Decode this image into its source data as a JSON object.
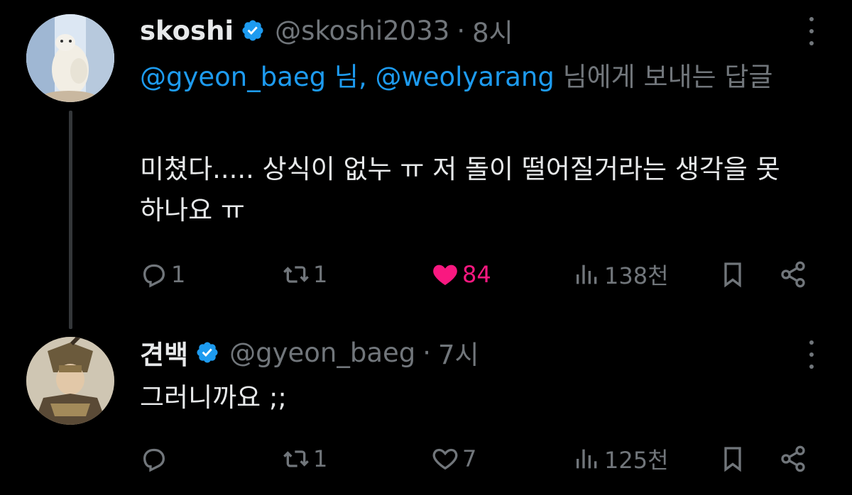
{
  "tweets": [
    {
      "name": "skoshi",
      "handle": "@skoshi2033",
      "separator": "·",
      "time": "8시",
      "reply_to": {
        "mentions": [
          "@gyeon_baeg 님,",
          "@weolyarang"
        ],
        "suffix": " 님에게 보내는 답글"
      },
      "text": "미쳤다..... 상식이 없누 ㅠ 저 돌이 떨어질거라는 생각을 못하나요 ㅠ",
      "stats": {
        "replies": "1",
        "retweets": "1",
        "likes": "84",
        "views": "138천"
      },
      "liked": true
    },
    {
      "name": "견백",
      "handle": "@gyeon_baeg",
      "separator": "·",
      "time": "7시",
      "text": "그러니까요 ;;",
      "stats": {
        "replies": "",
        "retweets": "1",
        "likes": "7",
        "views": "125천"
      },
      "liked": false
    }
  ],
  "colors": {
    "background": "#000000",
    "text": "#e7e9ea",
    "muted": "#71767b",
    "link": "#1d9bf0",
    "like": "#f91880"
  },
  "icons": [
    "verified-badge-icon",
    "more-icon",
    "reply-icon",
    "retweet-icon",
    "heart-icon",
    "views-icon",
    "bookmark-icon",
    "share-icon"
  ]
}
